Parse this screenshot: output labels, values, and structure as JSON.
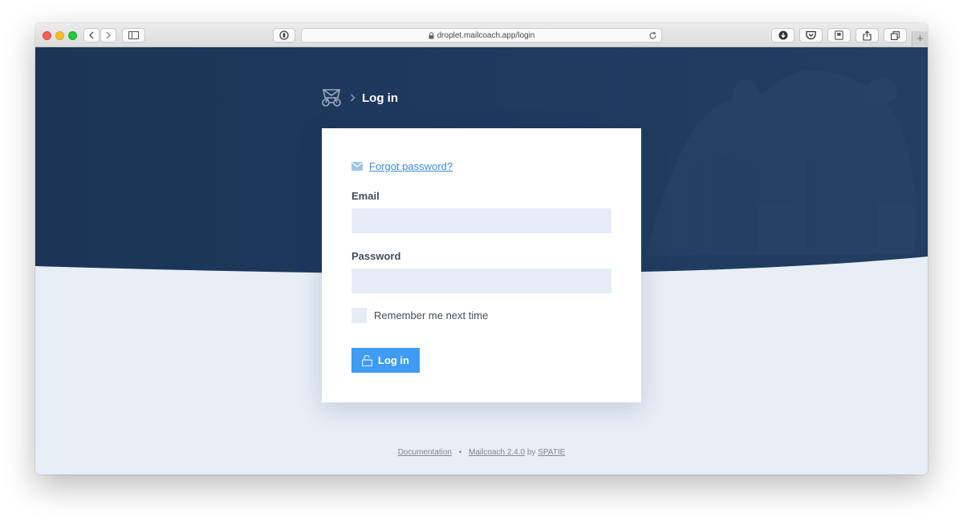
{
  "browser": {
    "url": "droplet.mailcoach.app/login",
    "icons": {
      "back": "chevron-left-icon",
      "forward": "chevron-right-icon",
      "sidebar": "sidebar-icon",
      "privacy": "privacy-report-icon",
      "lock": "lock-icon",
      "reload": "reload-icon",
      "download": "download-icon",
      "pocket": "pocket-icon",
      "extension": "extension-icon",
      "share": "share-icon",
      "tabs": "tab-overview-icon"
    }
  },
  "header": {
    "logo_icon": "mailcoach-logo-icon",
    "separator_icon": "chevron-right-icon",
    "title": "Log in"
  },
  "form": {
    "forgot_password_link": "Forgot password?",
    "forgot_password_icon": "envelope-icon",
    "email_label": "Email",
    "email_value": "",
    "password_label": "Password",
    "password_value": "",
    "remember_label": "Remember me next time",
    "remember_checked": false,
    "submit_label": "Log in",
    "submit_icon": "unlock-icon"
  },
  "footer": {
    "documentation_link": "Documentation",
    "separator": "•",
    "version_link": "Mailcoach 2.4.0",
    "by_text": "by",
    "vendor_link": "SPATIE"
  },
  "colors": {
    "hero_background": "#1d3758",
    "page_background": "#e8eef6",
    "accent": "#3f9cf3",
    "link": "#3b8ed8",
    "input_background": "#e6edf7"
  }
}
